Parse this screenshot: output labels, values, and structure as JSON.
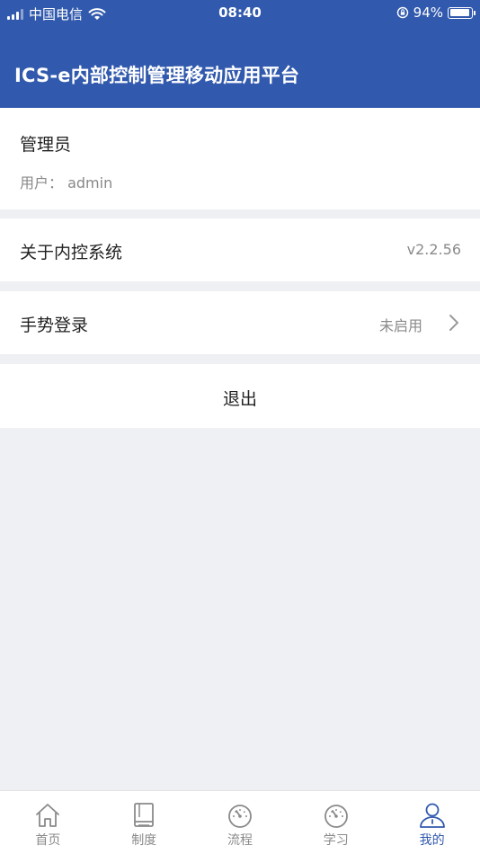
{
  "status_bar": {
    "carrier": "中国电信",
    "time": "08:40",
    "battery": "94%",
    "battery_level": 0.94
  },
  "header": {
    "title": "ICS-e内部控制管理移动应用平台",
    "bg_color": "#3159ad"
  },
  "user": {
    "role": "管理员",
    "user_line": "用户： admin"
  },
  "rows": {
    "about": {
      "label": "关于内控系统",
      "value": "v2.2.56"
    },
    "gesture": {
      "label": "手势登录",
      "value": "未启用"
    }
  },
  "logout_label": "退出",
  "tabs": [
    {
      "label": "首页",
      "icon": "home-icon"
    },
    {
      "label": "制度",
      "icon": "book-icon"
    },
    {
      "label": "流程",
      "icon": "gauge-icon"
    },
    {
      "label": "学习",
      "icon": "gauge-icon"
    },
    {
      "label": "我的",
      "icon": "person-icon",
      "active": true
    }
  ],
  "colors": {
    "accent": "#3159ad",
    "background": "#eff0f4",
    "tab_inactive": "#8a8a8a"
  }
}
